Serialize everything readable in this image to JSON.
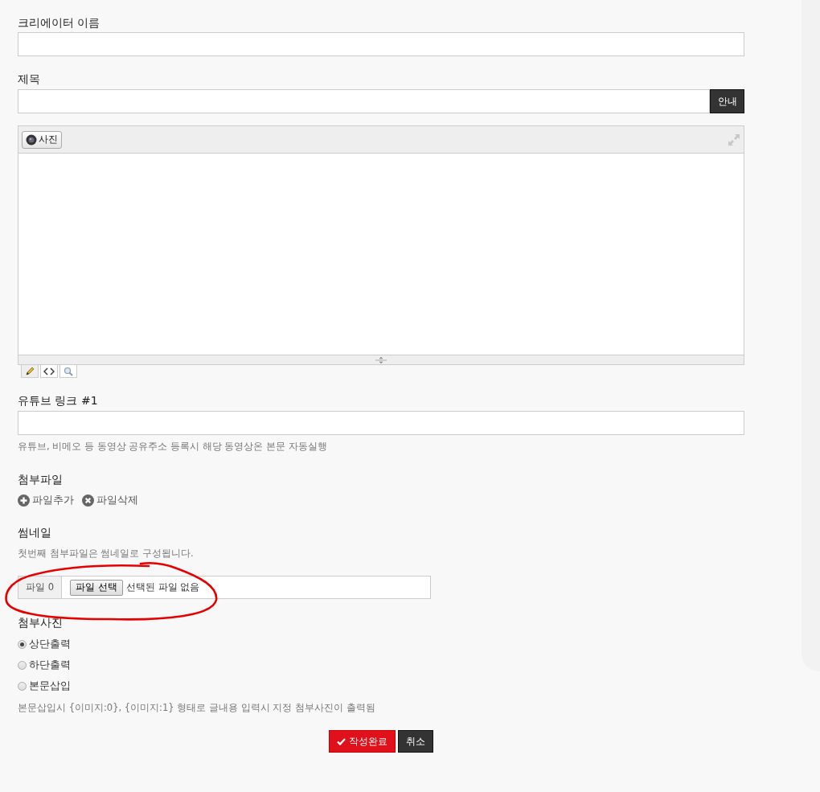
{
  "fields": [
    {
      "label": "크리에이터 이름"
    },
    {
      "label": "제목",
      "button": "안내"
    }
  ],
  "editor": {
    "photo_button": "사진",
    "modes": [
      {
        "kind": "pencil",
        "selected": true
      },
      {
        "kind": "code",
        "selected": false
      },
      {
        "kind": "preview",
        "selected": false
      }
    ]
  },
  "youtube": {
    "label": "유튜브 링크 #1",
    "help": "유튜브, 비메오 등 동영상 공유주소 등록시 해당 동영상온 본문 자동실행"
  },
  "attachments": {
    "label": "첨부파일",
    "actions": [
      {
        "kind": "add",
        "label": "파일추가"
      },
      {
        "kind": "delete",
        "label": "파일삭제"
      }
    ]
  },
  "thumbnail": {
    "label": "썸네일",
    "help": "첫번째 첨부파일은 썸네일로 구성됩니다.",
    "file_label": "파일 0",
    "choose_button": "파일 선택",
    "file_status": "선택된 파일 없음"
  },
  "photo_position": {
    "label": "첨부사진",
    "options": [
      {
        "label": "상단출력",
        "selected": true
      },
      {
        "label": "하단출력",
        "selected": false
      },
      {
        "label": "본문삽입",
        "selected": false
      }
    ],
    "help": "본문삽입시 {이미지:0}, {이미지:1} 형태로 글내용 입력시 지정 첨부사진이 출력됨"
  },
  "buttons": [
    {
      "kind": "submit",
      "label": "작성완료"
    },
    {
      "kind": "cancel",
      "label": "취소"
    }
  ]
}
